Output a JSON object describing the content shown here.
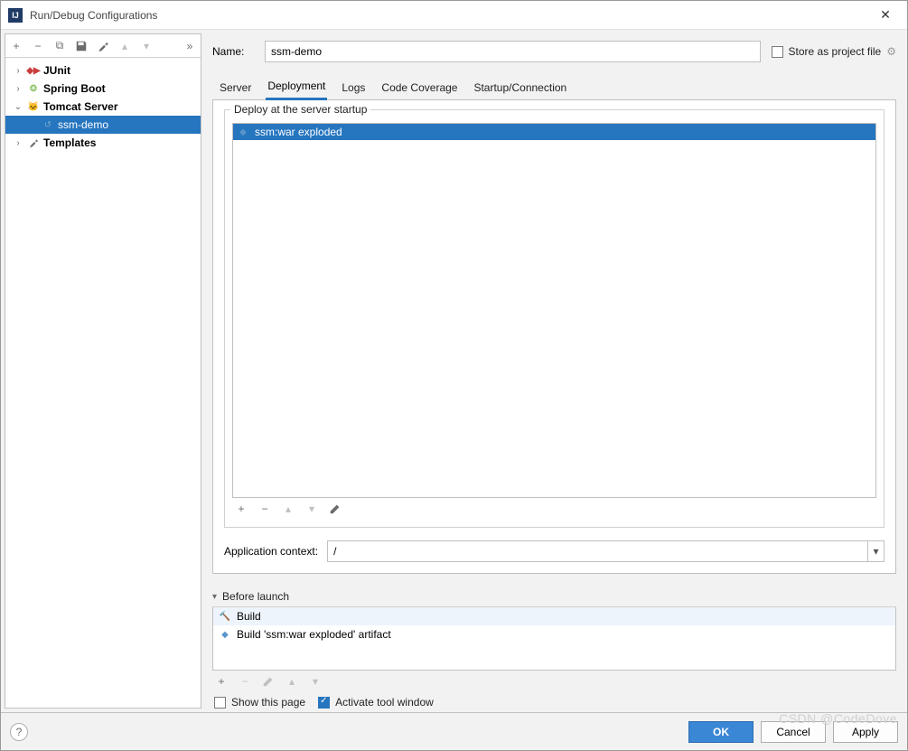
{
  "window": {
    "title": "Run/Debug Configurations"
  },
  "toolbar": {
    "add": "+",
    "remove": "−",
    "copy": "⧉",
    "save": "💾",
    "wrench": "🔧",
    "up": "▴",
    "down": "▾",
    "more": "»"
  },
  "tree": {
    "junit": {
      "label": "JUnit"
    },
    "spring": {
      "label": "Spring Boot"
    },
    "tomcat": {
      "label": "Tomcat Server"
    },
    "ssm": {
      "label": "ssm-demo"
    },
    "templates": {
      "label": "Templates"
    }
  },
  "name_row": {
    "label": "Name:",
    "value": "ssm-demo",
    "store_label": "Store as project file"
  },
  "tabs": {
    "server": "Server",
    "deployment": "Deployment",
    "logs": "Logs",
    "coverage": "Code Coverage",
    "startup": "Startup/Connection"
  },
  "deploy": {
    "header": "Deploy at the server startup",
    "item": "ssm:war exploded",
    "ctx_label": "Application context:",
    "ctx_value": "/"
  },
  "before": {
    "header": "Before launch",
    "build": "Build",
    "artifact": "Build 'ssm:war exploded' artifact",
    "show_page": "Show this page",
    "activate_tw": "Activate tool window"
  },
  "footer": {
    "ok": "OK",
    "cancel": "Cancel",
    "apply": "Apply"
  },
  "watermark": "CSDN @CodeDove"
}
